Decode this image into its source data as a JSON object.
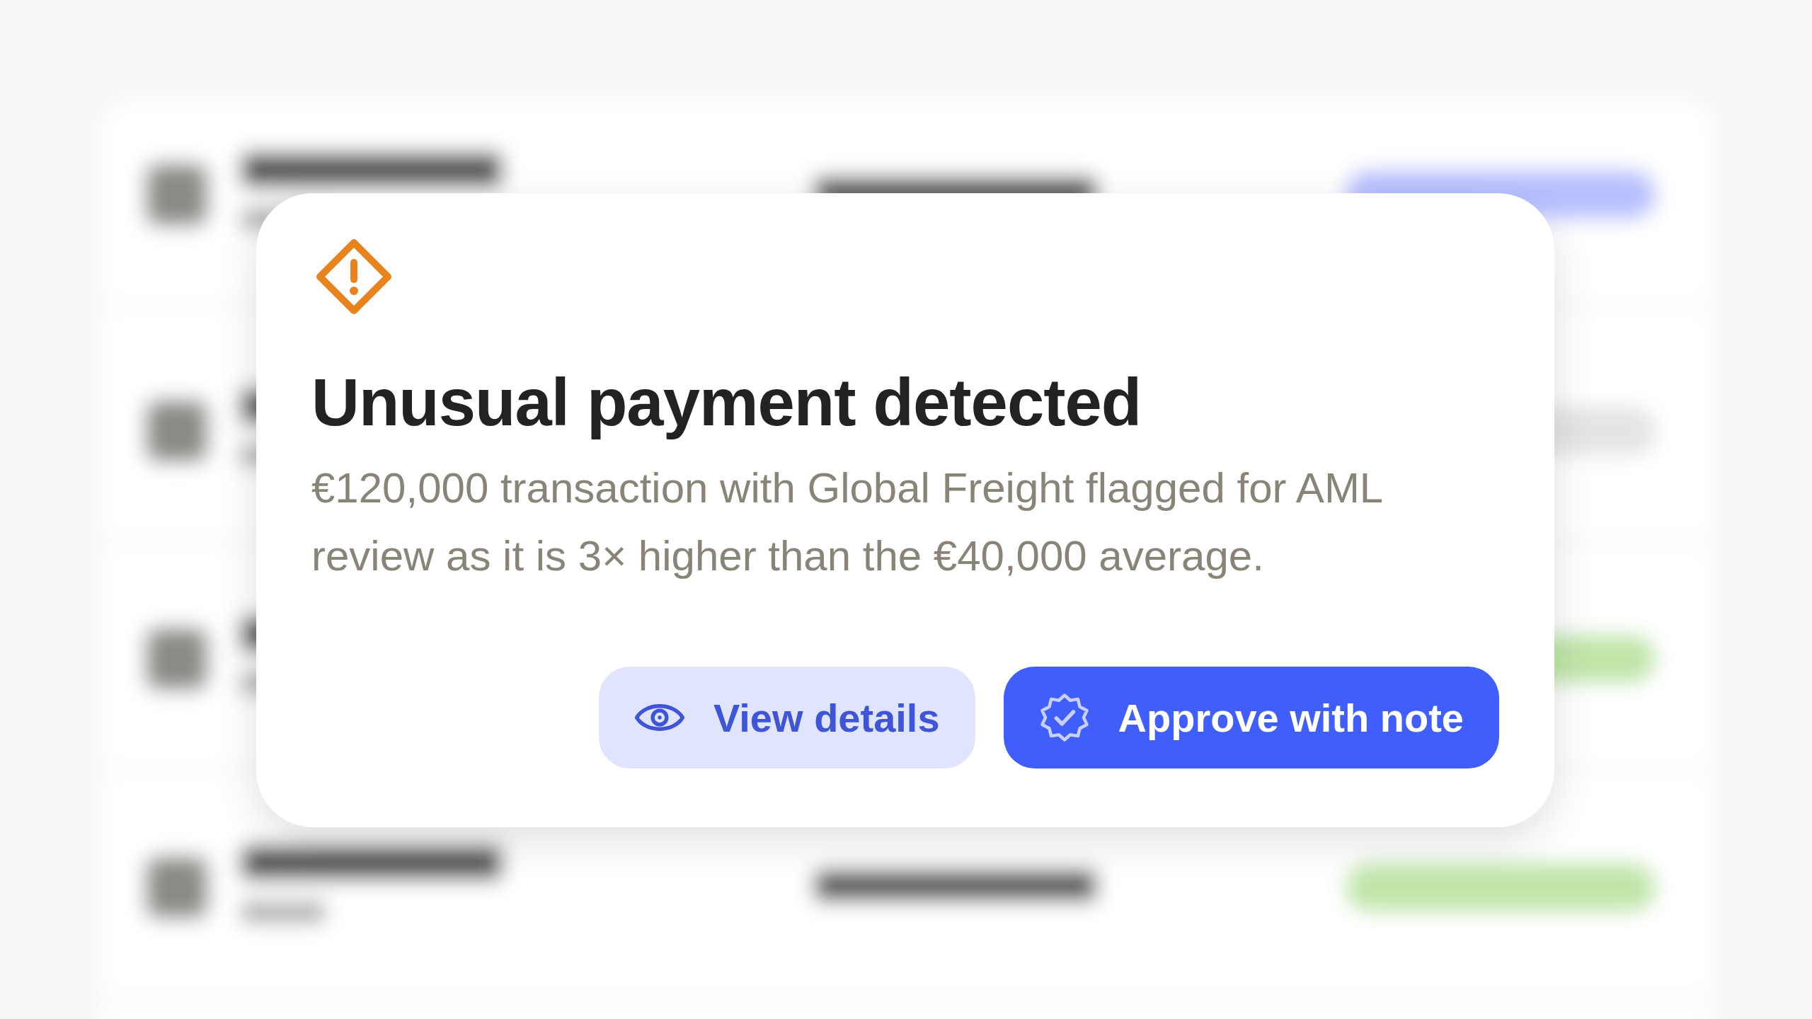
{
  "alert": {
    "title": "Unusual payment detected",
    "message": "€120,000 transaction with Global Freight flagged for AML review as it is 3× higher than the €40,000 average.",
    "buttons": [
      {
        "label": "View details",
        "kind": "secondary"
      },
      {
        "label": "Approve with note",
        "kind": "primary"
      }
    ]
  }
}
